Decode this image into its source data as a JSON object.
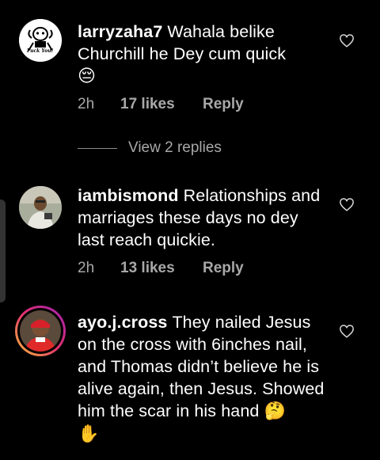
{
  "comments": [
    {
      "username": "larryzaha7",
      "text": "Wahala belike Churchill he Dey cum quick",
      "emoji": "😔",
      "time": "2h",
      "likes": "17 likes",
      "reply": "Reply",
      "avatar_text": "Fuck You!"
    },
    {
      "username": "iambismond",
      "text": "Relationships and marriages these days no dey last reach quickie.",
      "time": "2h",
      "likes": "13 likes",
      "reply": "Reply"
    },
    {
      "username": "ayo.j.cross",
      "text": "They nailed Jesus on the cross with 6inches nail, and Thomas didn’t believe he is alive again, then Jesus. Showed him the scar in his hand",
      "emoji": "🤔",
      "emoji2": "✋"
    }
  ],
  "view_replies": "View 2 replies"
}
